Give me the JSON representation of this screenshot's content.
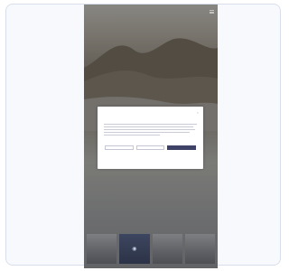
{
  "site": {
    "top_logo": "",
    "menu_icon": "hamburger-menu-icon"
  },
  "cookie_modal": {
    "close_icon": "close-icon",
    "logo_text": "",
    "logo_subtext": "",
    "description": "",
    "buttons": {
      "settings_label": "",
      "reject_label": "",
      "accept_label": ""
    },
    "footer": {
      "left_title": "",
      "left_subtitle": "",
      "right_link": ""
    }
  },
  "thumbnails": [
    {
      "label": ""
    },
    {
      "label": ""
    },
    {
      "label": ""
    },
    {
      "label": ""
    }
  ]
}
